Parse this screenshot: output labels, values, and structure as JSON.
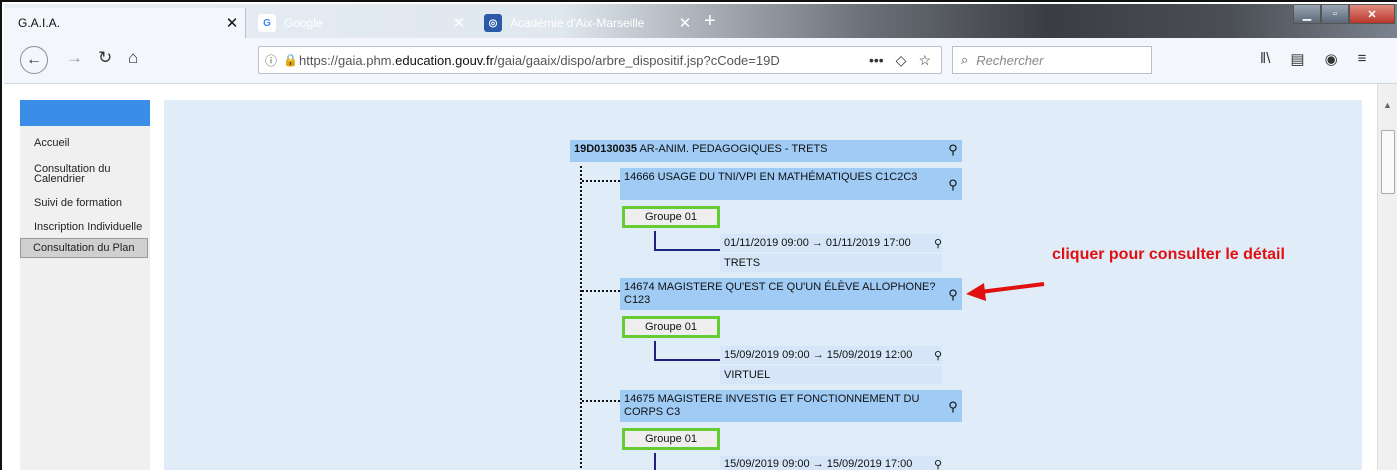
{
  "tabs": [
    {
      "title": "G.A.I.A.",
      "active": true
    },
    {
      "title": "Google",
      "icon": "google-icon"
    },
    {
      "title": "Académie d'Aix-Marseille",
      "icon": "academie-icon"
    }
  ],
  "navbar": {
    "url_prefix": "https://gaia.phm.",
    "url_domain": "education.gouv.fr",
    "url_suffix": "/gaia/gaaix/dispo/arbre_dispositif.jsp?cCode=19D",
    "search_placeholder": "Rechercher"
  },
  "sidebar": {
    "items": [
      {
        "label": "Accueil"
      },
      {
        "label": "Consultation du Calendrier"
      },
      {
        "label": "Suivi de formation"
      },
      {
        "label": "Inscription Individuelle"
      },
      {
        "label": "Consultation du Plan",
        "selected": true
      }
    ]
  },
  "tree": {
    "root_code": "19D0130035",
    "root_label": "AR-ANIM. PEDAGOGIQUES - TRETS",
    "modules": [
      {
        "label": "14666 USAGE DU TNI/VPI EN MATHÉMATIQUES C1C2C3",
        "group": "Groupe 01",
        "session": "01/11/2019 09:00 → 01/11/2019 17:00",
        "place": "TRETS"
      },
      {
        "label": "14674 MAGISTERE QU'EST CE QU'UN ÉLÈVE ALLOPHONE? C123",
        "group": "Groupe 01",
        "session": "15/09/2019 09:00 → 15/09/2019 12:00",
        "place": "VIRTUEL"
      },
      {
        "label": "14675 MAGISTERE INVESTIG ET FONCTIONNEMENT DU CORPS C3",
        "group": "Groupe 01",
        "session": "15/09/2019 09:00 → 15/09/2019 17:00"
      }
    ]
  },
  "annotation": {
    "text": "cliquer pour consulter le détail",
    "color": "#e01010"
  }
}
